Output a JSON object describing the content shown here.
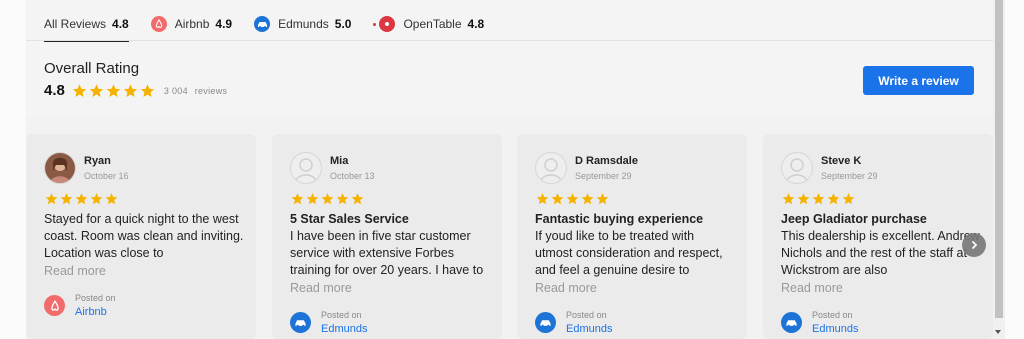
{
  "tabs": [
    {
      "label": "All Reviews",
      "score": "4.8",
      "icon": "none",
      "active": true
    },
    {
      "label": "Airbnb",
      "score": "4.9",
      "icon": "airbnb-icon"
    },
    {
      "label": "Edmunds",
      "score": "5.0",
      "icon": "edmunds-icon"
    },
    {
      "label": "OpenTable",
      "score": "4.8",
      "icon": "opentable-icon"
    }
  ],
  "overall": {
    "title": "Overall Rating",
    "score": "4.8",
    "stars": 5,
    "count": "3 004",
    "count_label": "reviews",
    "write_button": "Write a review"
  },
  "colors": {
    "accent": "#1a73e8",
    "star": "#f5b301",
    "airbnb": "#f26b6b",
    "edmunds": "#1e73d6",
    "opentable": "#da3743"
  },
  "reviews": [
    {
      "name": "Ryan",
      "date": "October 16",
      "stars": 5,
      "title": "",
      "text": "Stayed for a quick night to the west coast. Room was clean and inviting. Location was close to",
      "read_more": "Read more",
      "posted_on": "Posted on",
      "source": "Airbnb",
      "avatar": "photo"
    },
    {
      "name": "Mia",
      "date": "October 13",
      "stars": 5,
      "title": "5 Star Sales Service",
      "text": "I have been in five star customer service with extensive Forbes training for over 20 years. I have to",
      "read_more": "Read more",
      "posted_on": "Posted on",
      "source": "Edmunds",
      "avatar": "placeholder"
    },
    {
      "name": "D Ramsdale",
      "date": "September 29",
      "stars": 5,
      "title": "Fantastic buying experience",
      "text": "If youd like to be treated with utmost consideration and respect, and feel a genuine desire to",
      "read_more": "Read more",
      "posted_on": "Posted on",
      "source": "Edmunds",
      "avatar": "placeholder"
    },
    {
      "name": "Steve K",
      "date": "September 29",
      "stars": 5,
      "title": "Jeep Gladiator purchase",
      "text": "This dealership is excellent. Andrew Nichols and the rest of the staff at Wickstrom are also",
      "read_more": "Read more",
      "posted_on": "Posted on",
      "source": "Edmunds",
      "avatar": "placeholder"
    }
  ]
}
